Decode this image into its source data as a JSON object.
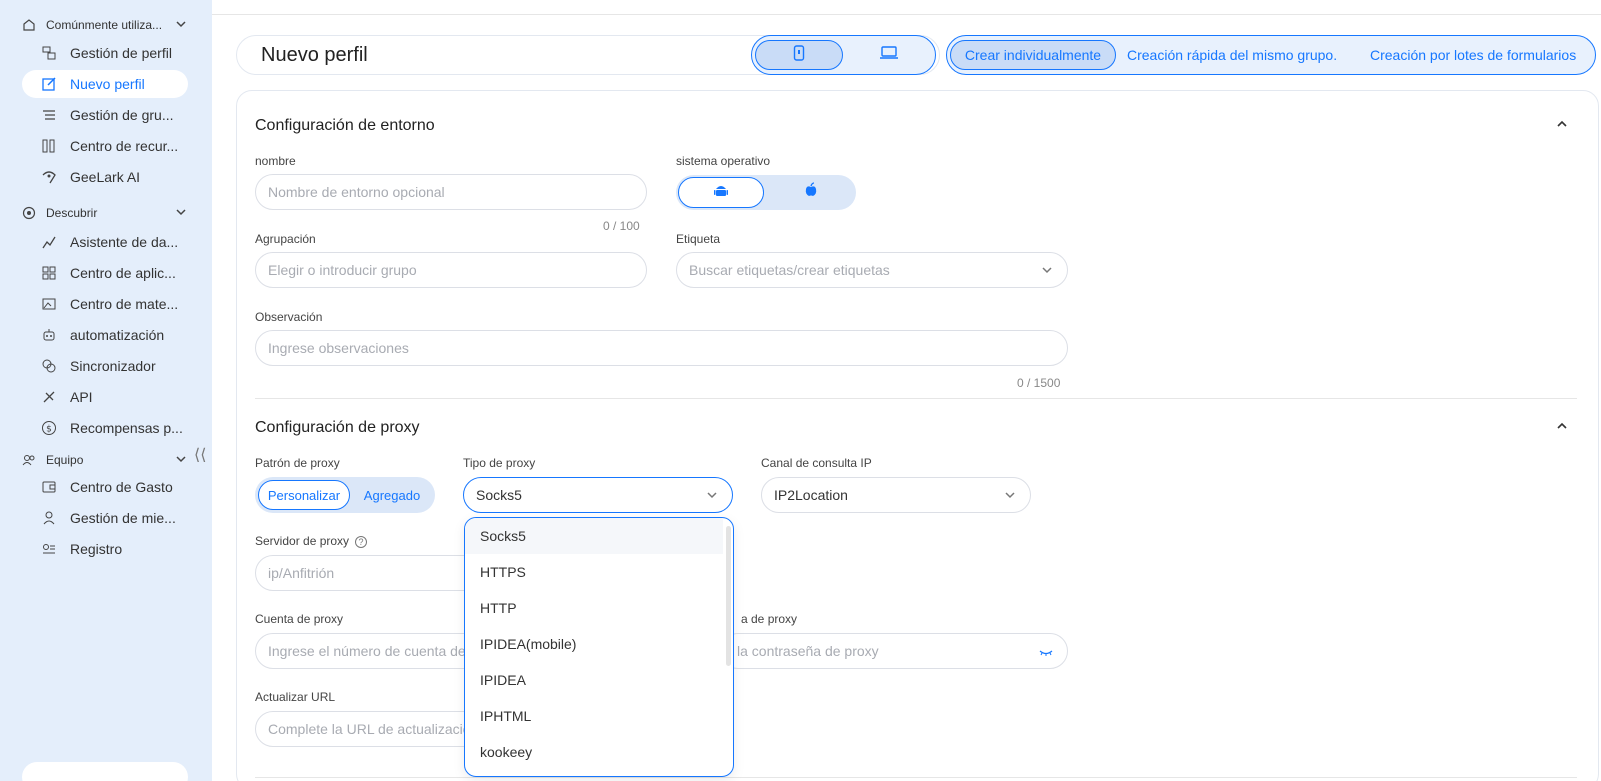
{
  "sidebar": {
    "group_common": "Comúnmente utiliza...",
    "items_common": [
      "Gestión de perfil",
      "Nuevo perfil",
      "Gestión de gru...",
      "Centro de recur...",
      "GeeLark AI"
    ],
    "group_discover": "Descubrir",
    "items_discover": [
      "Asistente de da...",
      "Centro de aplic...",
      "Centro de mate...",
      "automatización",
      "Sincronizador",
      "API",
      "Recompensas p..."
    ],
    "group_team": "Equipo",
    "items_team": [
      "Centro de Gasto",
      "Gestión de mie...",
      "Registro"
    ],
    "collapse_glyph": "⟨⟨"
  },
  "header": {
    "title": "Nuevo perfil",
    "modes": [
      "Crear individualmente",
      "Creación rápida del mismo grupo.",
      "Creación por lotes de formularios"
    ]
  },
  "env": {
    "title": "Configuración de entorno",
    "name_label": "nombre",
    "name_placeholder": "Nombre de entorno opcional",
    "name_counter": "0 / 100",
    "os_label": "sistema operativo",
    "group_label": "Agrupación",
    "group_placeholder": "Elegir o introducir grupo",
    "tag_label": "Etiqueta",
    "tag_placeholder": "Buscar etiquetas/crear etiquetas",
    "note_label": "Observación",
    "note_placeholder": "Ingrese observaciones",
    "note_counter": "0 / 1500"
  },
  "proxy": {
    "title": "Configuración de proxy",
    "pattern_label": "Patrón de proxy",
    "pattern_options": [
      "Personalizar",
      "Agregado"
    ],
    "type_label": "Tipo de proxy",
    "type_value": "Socks5",
    "channel_label": "Canal de consulta IP",
    "channel_value": "IP2Location",
    "server_label": "Servidor de proxy",
    "server_placeholder": "ip/Anfitrión",
    "account_label": "Cuenta de proxy",
    "account_placeholder": "Ingrese el número de cuenta de",
    "password_label": "a de proxy",
    "password_placeholder": "la contraseña de proxy",
    "url_label": "Actualizar URL",
    "url_placeholder": "Complete la URL de actualizació",
    "type_options": [
      "Socks5",
      "HTTPS",
      "HTTP",
      "IPIDEA(mobile)",
      "IPIDEA",
      "IPHTML",
      "kookeey"
    ]
  },
  "colors": {
    "accent": "#1677ff",
    "sidebar_bg": "#e4eefb"
  }
}
